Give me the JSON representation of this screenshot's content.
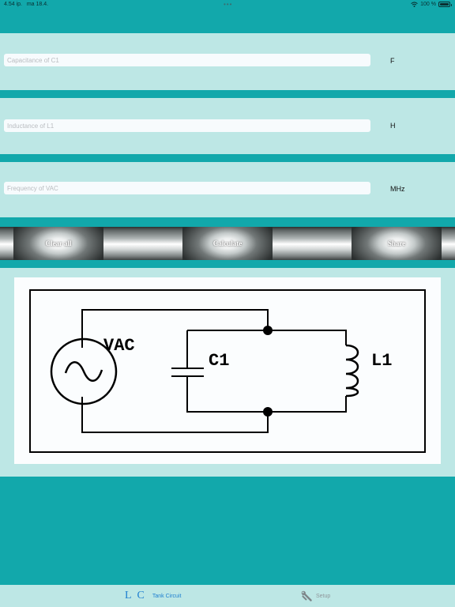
{
  "status_bar": {
    "time": "4.54 ip.",
    "date": "ma 18.4.",
    "battery": "100 %",
    "icons": [
      "wifi-icon",
      "battery-icon"
    ]
  },
  "inputs": [
    {
      "placeholder": "Capacitance of C1",
      "value": "",
      "unit": "F"
    },
    {
      "placeholder": "Inductance of L1",
      "value": "",
      "unit": "H"
    },
    {
      "placeholder": "Frequency of VAC",
      "value": "",
      "unit": "MHz"
    }
  ],
  "buttons": {
    "clear": "Clear all",
    "calculate": "Calculate",
    "share": "Share"
  },
  "diagram": {
    "source_label": "VAC",
    "capacitor_label": "C1",
    "inductor_label": "L1"
  },
  "tabs": [
    {
      "icon_text": "L C",
      "label": "Tank Circuit",
      "selected": true
    },
    {
      "icon": "wrench-icon",
      "label": "Setup",
      "selected": false
    }
  ],
  "colors": {
    "background": "#12a8ab",
    "band": "#bde7e5",
    "tab_selected": "#1e7fd0",
    "tab_unselected": "#8f979b"
  }
}
